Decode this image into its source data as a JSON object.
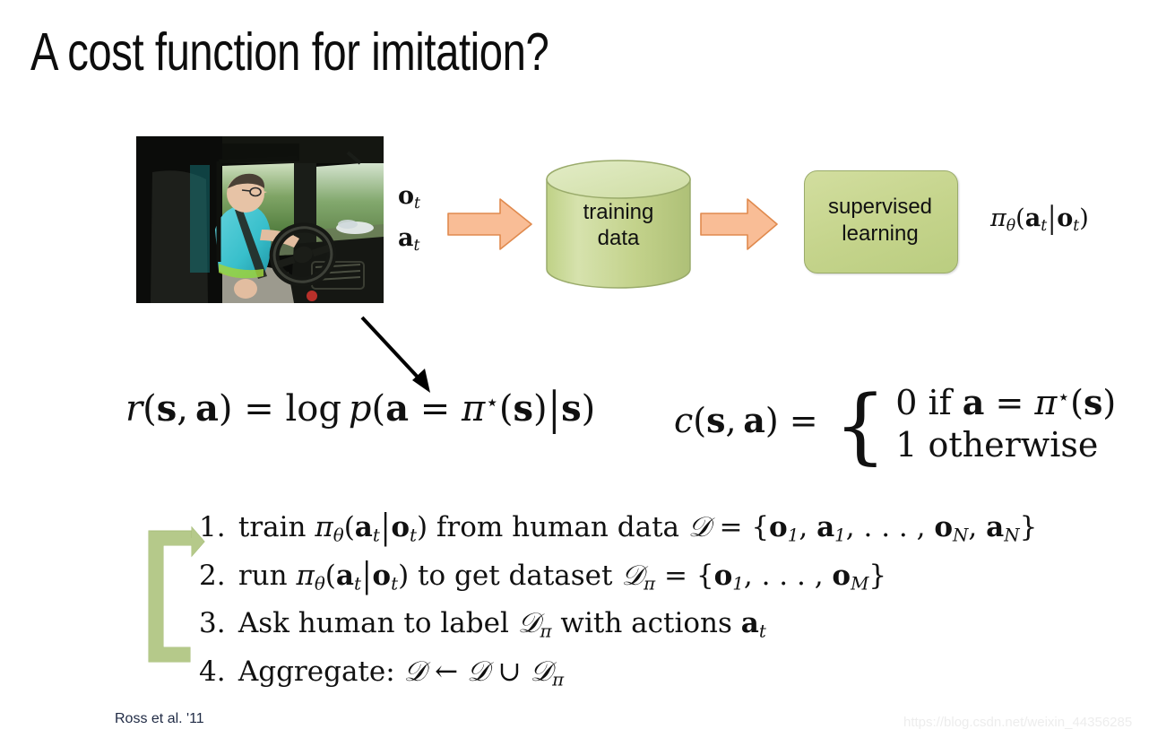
{
  "slide": {
    "title": "A cost function for imitation?",
    "citation": "Ross et al. '11",
    "watermark": "https://blog.csdn.net/weixin_44356285",
    "background_color": "#ffffff"
  },
  "colors": {
    "arrow_orange_fill": "#f9bd96",
    "arrow_orange_border": "#e08a4e",
    "green_fill": "#c6d48e",
    "green_border": "#9aab6b",
    "green_top": "#dde7b9",
    "loop_arrow_green": "#b5c98a",
    "title_text": "#0d0d0d",
    "citation_text": "#1f2a44",
    "watermark_text": "#ededed"
  },
  "photo": {
    "alt": "truck driver in cab holding steering wheel",
    "icon": "truck-cab-photo"
  },
  "diagram": {
    "input_label_observation": "o",
    "input_label_observation_sub": "t",
    "input_label_action": "a",
    "input_label_action_sub": "t",
    "arrow1": "right-arrow-icon",
    "cylinder_label_line1": "training",
    "cylinder_label_line2": "data",
    "arrow2": "right-arrow-icon",
    "box_label_line1": "supervised",
    "box_label_line2": "learning",
    "policy_output": "πθ(a t|o t)",
    "black_arrow": "diagonal-arrow-icon"
  },
  "equations": {
    "reward": {
      "lhs_fn": "r",
      "lhs_args": "(s, a)",
      "rhs": "= log p(a = π⋆(s)|s)",
      "plain": "r(s,a) = log p(a = π*(s)|s)"
    },
    "cost": {
      "lhs_fn": "c",
      "lhs_args": "(s, a)",
      "case1": "0 if a = π⋆(s)",
      "case2": "1 otherwise",
      "plain": "c(s,a) = { 0 if a = π*(s); 1 otherwise }"
    }
  },
  "algorithm": {
    "loop_arrow": "loop-back-arrow-icon",
    "steps": [
      {
        "number": "1.",
        "text_before": "train",
        "policy": "πθ(a t|o t)",
        "text_mid": "from human data",
        "dataset": "D = {o 1, a 1, … , o N, a N}",
        "plain": "train πθ(a_t|o_t) from human data D = {o_1, a_1, ..., o_N, a_N}"
      },
      {
        "number": "2.",
        "text_before": "run",
        "policy": "πθ(a t|o t)",
        "text_mid": "to get dataset",
        "dataset": "Dπ = {o 1, … , o M}",
        "plain": "run πθ(a_t|o_t) to get dataset D_π = {o_1, ..., o_M}"
      },
      {
        "number": "3.",
        "text_before": "Ask human to label",
        "dataset": "Dπ",
        "text_mid": "with actions",
        "policy": "a t",
        "plain": "Ask human to label D_π with actions a_t"
      },
      {
        "number": "4.",
        "text_before": "Aggregate:",
        "dataset": "D ← D ∪ Dπ",
        "plain": "Aggregate: D ← D ∪ D_π"
      }
    ]
  }
}
